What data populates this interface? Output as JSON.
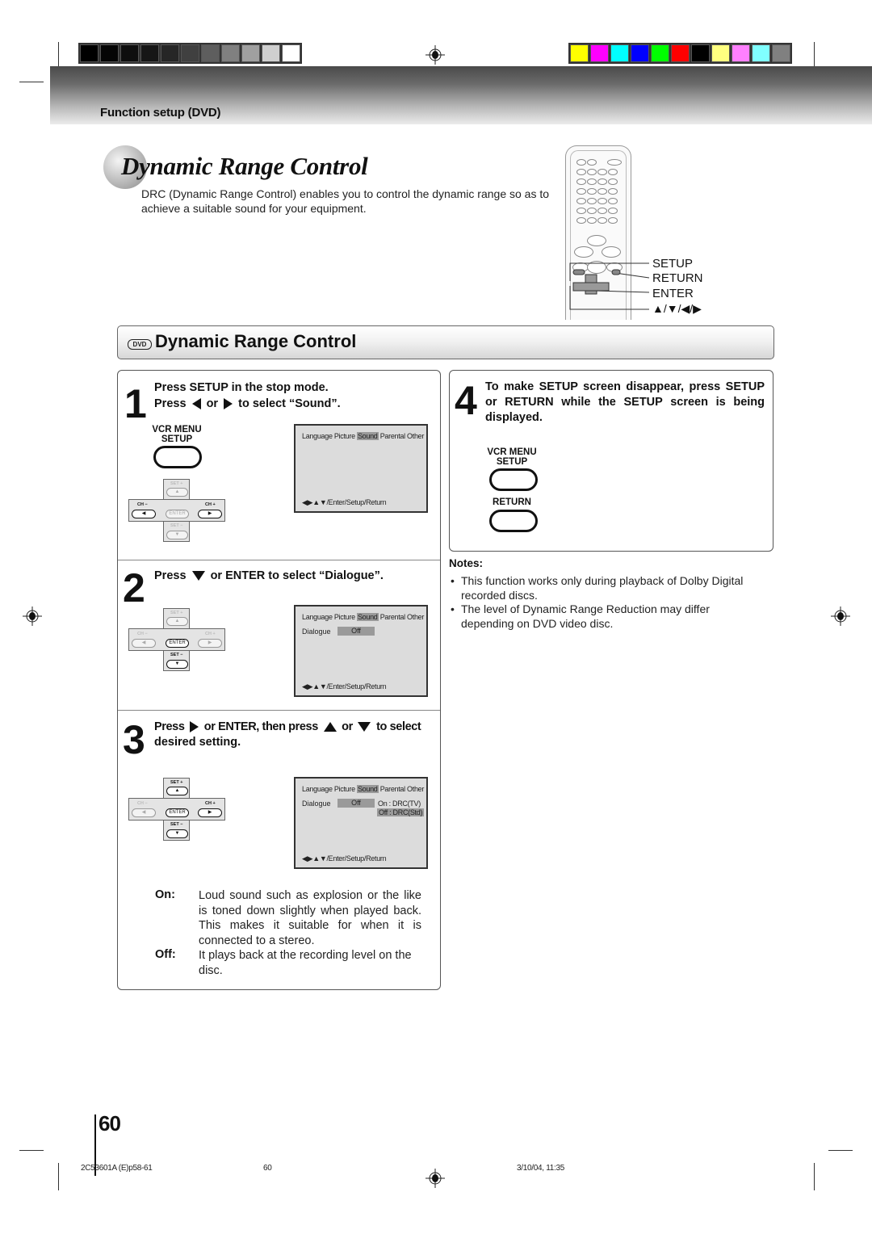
{
  "print_marks": {
    "grayscale_swatches": [
      "#000000",
      "#050505",
      "#0e0e0e",
      "#161616",
      "#262626",
      "#404040",
      "#5e5e5e",
      "#808080",
      "#a0a0a0",
      "#cfcfcf",
      "#ffffff"
    ],
    "color_swatches": [
      "#ffff00",
      "#ff00ff",
      "#00ffff",
      "#0000ff",
      "#00ff00",
      "#ff0000",
      "#000000",
      "#ffff80",
      "#ff80ff",
      "#80ffff",
      "#808080"
    ]
  },
  "header": {
    "section_label": "Function setup (DVD)"
  },
  "title": {
    "text": "Dynamic Range Control",
    "intro": "DRC (Dynamic Range Control) enables you to control the dynamic range so as to achieve a suitable sound for your equipment."
  },
  "remote": {
    "labels": {
      "setup": "SETUP",
      "return": "RETURN",
      "enter": "ENTER",
      "arrows": "▲/▼/◀/▶"
    }
  },
  "section": {
    "badge": "DVD",
    "title": "Dynamic Range Control"
  },
  "steps": {
    "s1": {
      "number": "1",
      "line1": "Press SETUP in the stop mode.",
      "line2_a": "Press",
      "line2_or": "or",
      "line2_b": "to select “Sound”.",
      "button_caption_1": "VCR MENU",
      "button_caption_2": "SETUP"
    },
    "s2": {
      "number": "2",
      "text_a": "Press",
      "text_b": "or ENTER to select “Dialogue”."
    },
    "s3": {
      "number": "3",
      "text_a": "Press",
      "text_b": "or ENTER, then press",
      "text_c": "or",
      "text_d": "to select",
      "text_e": "desired setting."
    },
    "s4": {
      "number": "4",
      "text": "To make SETUP screen disappear, press SETUP or RETURN while the SETUP screen is being displayed.",
      "button_caption_1": "VCR MENU",
      "button_caption_2": "SETUP",
      "return_caption": "RETURN"
    }
  },
  "dpad": {
    "set_plus": "SET +",
    "set_minus": "SET −",
    "ch_minus": "CH −",
    "ch_plus": "CH +",
    "enter": "ENTER",
    "up": "▲",
    "down": "▼",
    "left": "◀",
    "right": "▶"
  },
  "osd": {
    "menu_items": [
      "Language",
      "Picture",
      "Sound",
      "Parental",
      "Other"
    ],
    "selected_menu": "Sound",
    "dialogue_label": "Dialogue",
    "dialogue_value": "Off",
    "option_on": "On : DRC(TV)",
    "option_off": "Off : DRC(Std)",
    "footer": "◀▶▲▼/Enter/Setup/Return"
  },
  "descriptions": {
    "on_term": "On:",
    "on_text": "Loud sound such as explosion or the like is toned down slightly when played back. This makes it suitable for when it is connected to a stereo.",
    "off_term": "Off:",
    "off_text": "It plays back at the recording level on the disc."
  },
  "notes": {
    "title": "Notes:",
    "items": [
      "This function works only during playback of Dolby Digital recorded discs.",
      "The level of Dynamic Range Reduction may differ depending on DVD video disc."
    ]
  },
  "footer": {
    "page_number": "60",
    "file_code": "2C53601A (E)p58-61",
    "page_ref": "60",
    "timestamp": "3/10/04, 11:35"
  }
}
